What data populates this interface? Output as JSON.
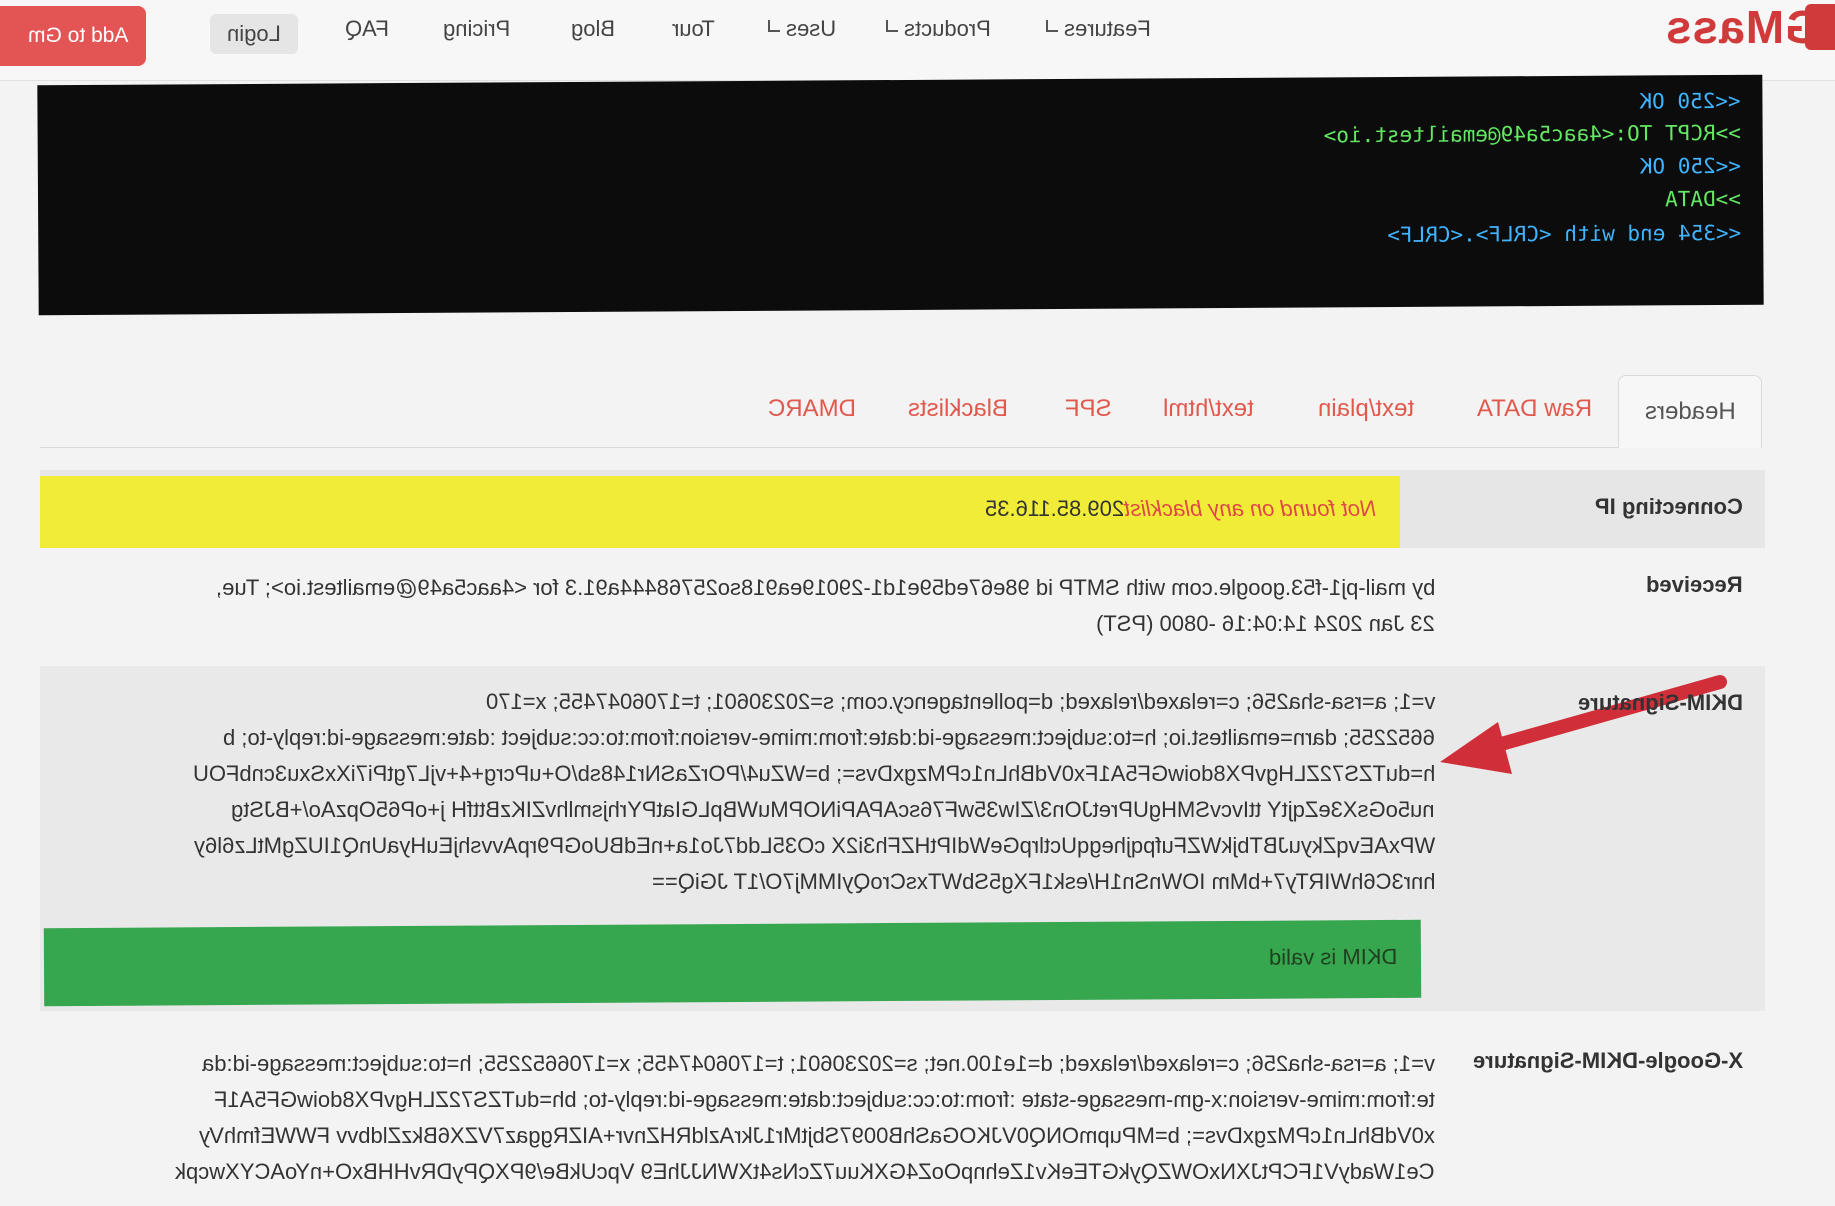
{
  "nav": {
    "brand": "GMass",
    "add_button": "Add to Gm",
    "items": [
      {
        "label": "Features",
        "dropdown": true
      },
      {
        "label": "Products",
        "dropdown": true
      },
      {
        "label": "Uses",
        "dropdown": true
      },
      {
        "label": "Tour",
        "dropdown": false
      },
      {
        "label": "Blog",
        "dropdown": false
      },
      {
        "label": "Pricing",
        "dropdown": false
      },
      {
        "label": "FAQ",
        "dropdown": false
      }
    ],
    "login": "Login"
  },
  "terminal": {
    "lines": [
      {
        "text": "<<250 OK",
        "color": "blue"
      },
      {
        "text": ">>RCPT TO:<4aac5a49@emailtest.io>",
        "color": "green"
      },
      {
        "text": "<<250 OK",
        "color": "blue"
      },
      {
        "text": ">>DATA",
        "color": "green"
      },
      {
        "text": "<<354 end with <CRLF>.<CRLF>",
        "color": "blue"
      }
    ],
    "colors": {
      "green": "#62e862",
      "blue": "#3fb5ff",
      "background": "#0c0c0c"
    }
  },
  "tabs": [
    {
      "label": "Headers",
      "active": true
    },
    {
      "label": "Raw DATA",
      "active": false
    },
    {
      "label": "text/plain",
      "active": false
    },
    {
      "label": "text/html",
      "active": false
    },
    {
      "label": "SPF",
      "active": false
    },
    {
      "label": "Blacklists",
      "active": false
    },
    {
      "label": "DMARC",
      "active": false
    }
  ],
  "headers": {
    "connecting_ip": {
      "label": "Connecting IP",
      "ip": "209.85.116.35",
      "status": "Not found on any blacklist",
      "band_color": "#f1ec37"
    },
    "received": {
      "label": "Received",
      "lines": [
        "by mail-pj1-f53.google.com with SMTP id 98e67ed59e1d1-29019ea918so25768444a91.3 for <4aac5a49@emailtest.io>; Tue,",
        "23 Jan 2024 14:04:16 -0800 (PST)"
      ]
    },
    "dkim_signature": {
      "label": "DKIM-Signature",
      "lines": [
        "v=1; a=rsa-sha256; c=relaxed/relaxed; d=pollentagency.com; s=20230601; t=1706047455; x=170",
        "6652255; darn=emailtest.io; h=to:subject:message-id:date:from:mime-version:from:to:cc:subject :date:message-id:reply-to; b",
        "h=duTZS72ZLHgvPX8doiwGF5A1Fx0VdBhLn1cPMzgxDvs=; b=WZu4/POrZaSNr148sb/O+uPcrg+4+vjL7gtPi7iXxSxu3cnbFOU",
        "nu5oGsX3eZqjtY ttIvcvSMHgUPretJOn3/ZIw35wF76scAPAPiNOPMuWBpLGIatPYrhjsmlhvZIKzBttfH j+oP65OpzAo/+BJStg",
        "WPxAEvqZkyuJBTbjkWZFufpqjhegqUctlrpGeWdIPtHZFh3i2X cO35Ldd7Jo1a+nEdBUoGP9rpAvvshjEuHyaUnQ1IUZgMtLz6l6y",
        "hnr3C6hWIRTy7+bMm IOWnSn1H/esk1FXg5SbWTxsCroQyIMMj7O/1T JGiQ=="
      ],
      "valid_text": "DKIM is valid",
      "valid_color": "#36a64f"
    },
    "x_google_dkim": {
      "label": "X-Google-DKIM-Signature",
      "lines": [
        "v=1; a=rsa-sha256; c=relaxed/relaxed; d=1e100.net; s=20230601; t=1706047455; x=1706652255; h=to:subject:message-id:da",
        "te:from:mime-version:x-gm-message-state :from:to:cc:subject:date:message-id:reply-to; bh=duTZS72ZLHgvPX8doiwGF5A1F",
        "x0VdBhLn1cPMzgxDvs=; b=MPupmONQ0VJKOGaShB0097SbjtMr1JkrAzldRHZnvr+AIZRggaz7VZX6BkzZldbvv FWWEfmhVy",
        "Ce1WadyV1FCPtJXNxOWZQykGTEeKv1ZehnpOoZ4GXKuu7ZcNs4tXWNJJhE9 VpcUkBe/9PXQPyDRvHHBxO+nYoACYXwcpk"
      ]
    }
  }
}
